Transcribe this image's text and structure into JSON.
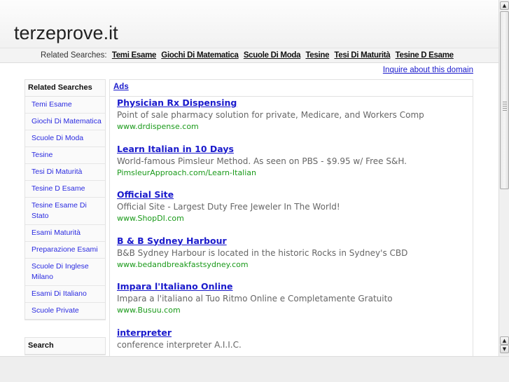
{
  "header": {
    "title": "terzeprove.it",
    "related_label": "Related Searches:",
    "related_links": [
      "Temi Esame",
      "Giochi Di Matematica",
      "Scuole Di Moda",
      "Tesine",
      "Tesi Di Maturità",
      "Tesine D Esame"
    ]
  },
  "inquire": "Inquire about this domain",
  "sidebar": {
    "heading": "Related Searches",
    "items": [
      "Temi Esame",
      "Giochi Di Matematica",
      "Scuole Di Moda",
      "Tesine",
      "Tesi Di Maturità",
      "Tesine D Esame",
      "Tesine Esame Di Stato",
      "Esami Maturità",
      "Preparazione Esami",
      "Scuole Di Inglese Milano",
      "Esami Di Italiano",
      "Scuole Private"
    ],
    "search_heading": "Search"
  },
  "ads": {
    "heading": "Ads",
    "items": [
      {
        "title": "Physician Rx Dispensing",
        "desc": "Point of sale pharmacy solution for private, Medicare, and Workers Comp",
        "url": "www.drdispense.com"
      },
      {
        "title": "Learn Italian in 10 Days",
        "desc": "World-famous Pimsleur Method. As seen on PBS - $9.95 w/ Free S&H.",
        "url": "PimsleurApproach.com/Learn-Italian"
      },
      {
        "title": "Official Site",
        "desc": "Official Site - Largest Duty Free Jeweler In The World!",
        "url": "www.ShopDI.com"
      },
      {
        "title": "B & B Sydney Harbour",
        "desc": "B&B Sydney Harbour is located in the historic Rocks in Sydney's CBD",
        "url": "www.bedandbreakfastsydney.com"
      },
      {
        "title": "Impara l'Italiano Online",
        "desc": "Impara a l'italiano al Tuo Ritmo Online e Completamente Gratuito",
        "url": "www.Busuu.com"
      },
      {
        "title": "interpreter",
        "desc": "conference interpreter A.I.I.C.",
        "url": ""
      }
    ]
  }
}
